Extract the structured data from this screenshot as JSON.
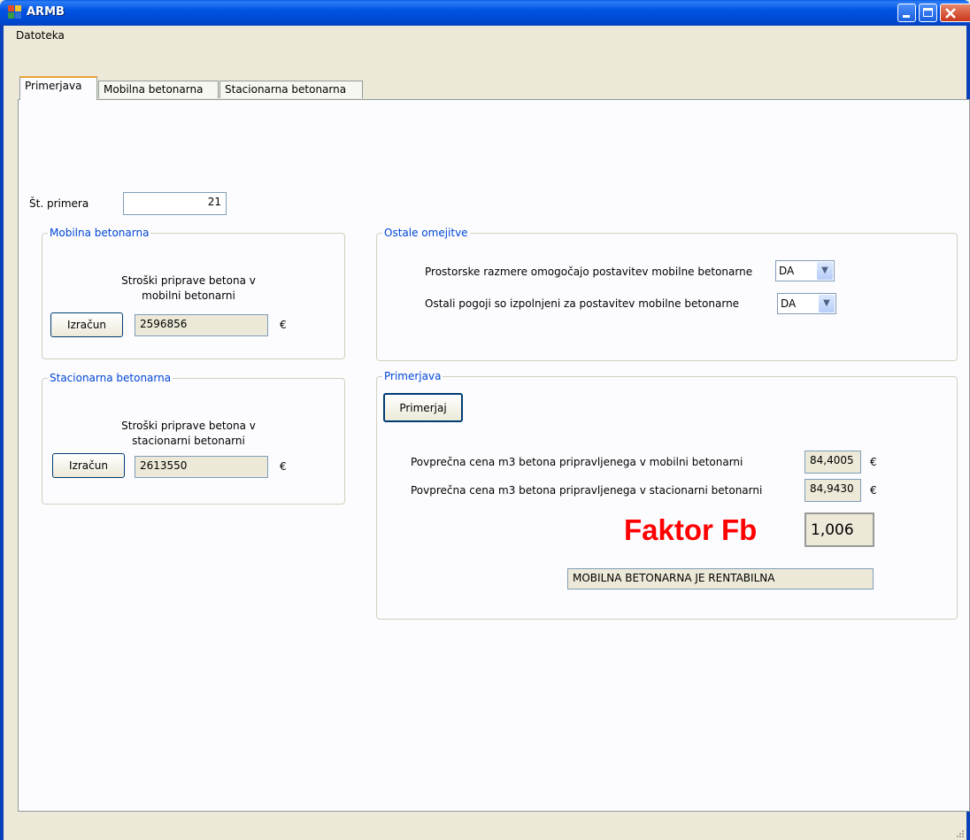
{
  "window": {
    "title": "ARMB"
  },
  "menu": {
    "file": "Datoteka"
  },
  "tabs": [
    "Primerjava",
    "Mobilna betonarna",
    "Stacionarna betonarna"
  ],
  "main": {
    "example_label": "Št. primera",
    "example_value": "21",
    "mobile_group": {
      "title": "Mobilna betonarna",
      "desc_line1": "Stroški priprave betona v",
      "desc_line2": "mobilni betonarni",
      "button": "Izračun",
      "value": "2596856",
      "currency": "€"
    },
    "stationary_group": {
      "title": "Stacionarna betonarna",
      "desc_line1": "Stroški priprave betona v",
      "desc_line2": "stacionarni betonarni",
      "button": "Izračun",
      "value": "2613550",
      "currency": "€"
    },
    "other_group": {
      "title": "Ostale omejitve",
      "q1": "Prostorske razmere omogočajo postavitev mobilne betonarne",
      "q1_value": "DA",
      "q2": "Ostali pogoji so izpolnjeni za postavitev mobilne betonarne",
      "q2_value": "DA"
    },
    "compare_group": {
      "title": "Primerjava",
      "button": "Primerjaj",
      "avg_mobile_label": "Povprečna cena m3 betona pripravljenega v mobilni betonarni",
      "avg_mobile_value": "84,4005",
      "avg_stationary_label": "Povprečna cena m3 betona pripravljenega v stacionarni betonarni",
      "avg_stationary_value": "84,9430",
      "currency": "€",
      "factor_label": "Faktor Fb",
      "factor_value": "1,006",
      "result": "MOBILNA BETONARNA JE RENTABILNA"
    }
  },
  "colors": {
    "titlebar": "#0054e3",
    "group_title": "#0046d5",
    "factor": "#ff0000",
    "tab_highlight": "#e8a33a"
  }
}
